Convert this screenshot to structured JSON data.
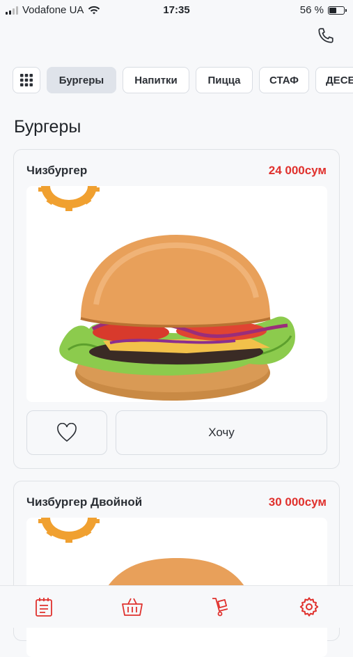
{
  "status_bar": {
    "carrier": "Vodafone UA",
    "time": "17:35",
    "battery": "56 %"
  },
  "colors": {
    "accent": "#e0312d",
    "logo_orange": "#f0a030",
    "background": "#f7f8fa"
  },
  "header": {
    "phone_icon": "phone-icon"
  },
  "categories": {
    "grid_icon": "grid-icon",
    "items": [
      {
        "label": "Бургеры",
        "active": true
      },
      {
        "label": "Напитки",
        "active": false
      },
      {
        "label": "Пицца",
        "active": false
      },
      {
        "label": "СТАФ",
        "active": false
      },
      {
        "label": "ДЕСЕ",
        "active": false
      }
    ]
  },
  "section": {
    "title": "Бургеры"
  },
  "products": [
    {
      "name": "Чизбургер",
      "price": "24 000сум",
      "action_label": "Хочу"
    },
    {
      "name": "Чизбургер Двойной",
      "price": "30 000сум"
    }
  ],
  "bottom_nav": [
    {
      "icon": "menu-document-icon"
    },
    {
      "icon": "basket-icon"
    },
    {
      "icon": "delivery-cart-icon"
    },
    {
      "icon": "settings-gear-icon"
    }
  ]
}
